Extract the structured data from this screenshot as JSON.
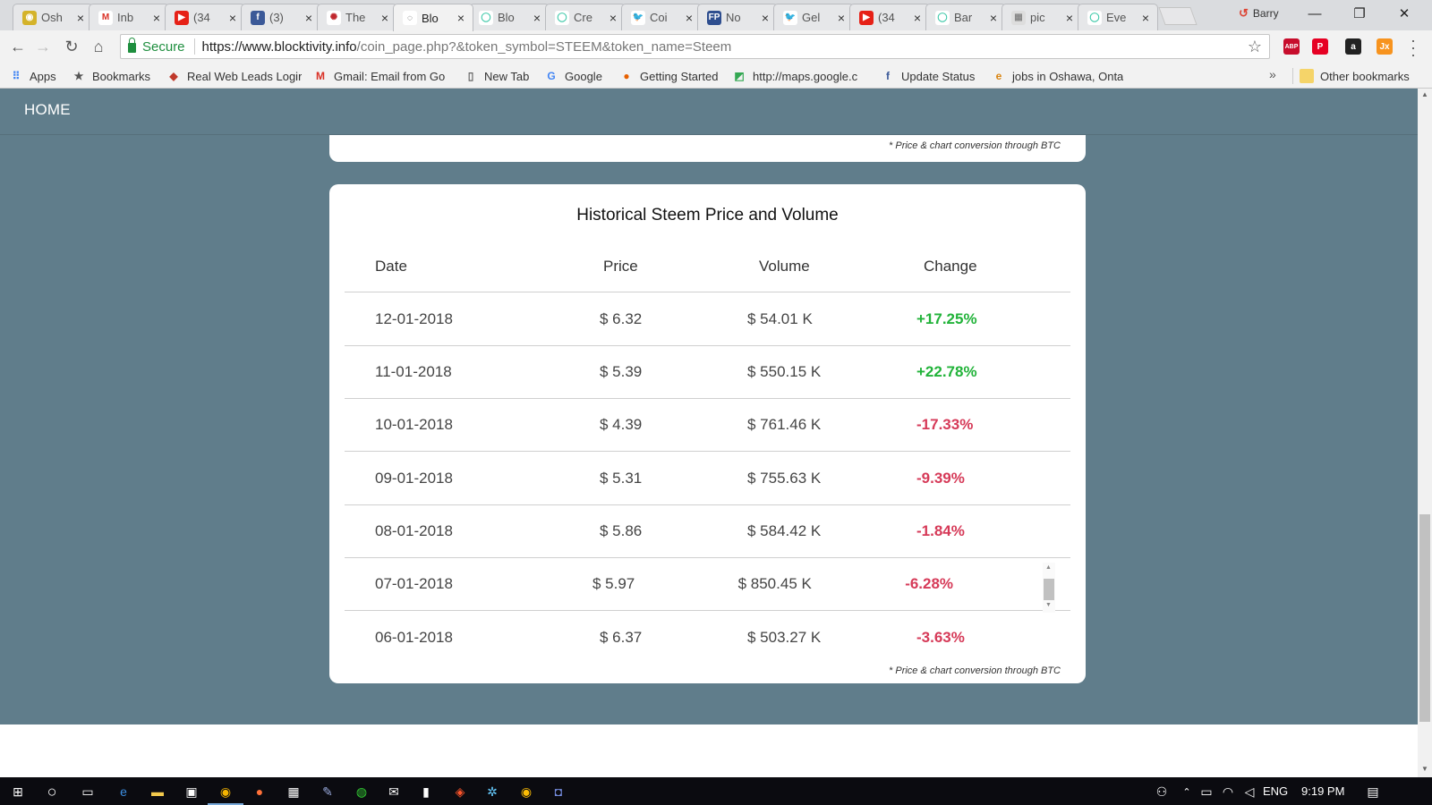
{
  "browser": {
    "tabs": [
      {
        "title": "Osh",
        "color": "#d4b32a",
        "glyph": "◉"
      },
      {
        "title": "Inb",
        "color": "#ffffff",
        "glyph": "M",
        "glyph_color": "#d93025"
      },
      {
        "title": "(34",
        "color": "#e62117",
        "glyph": "▶"
      },
      {
        "title": "(3)",
        "color": "#3b5998",
        "glyph": "f"
      },
      {
        "title": "The",
        "color": "#ffffff",
        "glyph": "✺",
        "glyph_color": "#c0272d"
      },
      {
        "title": "Blo",
        "color": "#ffffff",
        "glyph": "◌",
        "glyph_color": "#444"
      },
      {
        "title": "Blo",
        "color": "#ffffff",
        "glyph": "◯",
        "glyph_color": "#3cc8a8"
      },
      {
        "title": "Cre",
        "color": "#ffffff",
        "glyph": "◯",
        "glyph_color": "#3cc8a8"
      },
      {
        "title": "Coi",
        "color": "#ffffff",
        "glyph": "🐦",
        "glyph_color": "#1da1f2"
      },
      {
        "title": "No",
        "color": "#2e4e8f",
        "glyph": "FP"
      },
      {
        "title": "Gel",
        "color": "#ffffff",
        "glyph": "🐦",
        "glyph_color": "#1da1f2"
      },
      {
        "title": "(34",
        "color": "#e62117",
        "glyph": "▶"
      },
      {
        "title": "Bar",
        "color": "#ffffff",
        "glyph": "◯",
        "glyph_color": "#3cc8a8"
      },
      {
        "title": "pic",
        "color": "#dddddd",
        "glyph": "▦",
        "glyph_color": "#888"
      },
      {
        "title": "Eve",
        "color": "#ffffff",
        "glyph": "◯",
        "glyph_color": "#3cc8a8"
      }
    ],
    "active_tab_index": 5,
    "profile_name": "Barry",
    "window_controls": {
      "minimize": "—",
      "restore": "❐",
      "close": "✕"
    },
    "address": {
      "secure_label": "Secure",
      "url_host": "https://www.blocktivity.info",
      "url_rest": "/coin_page.php?&token_symbol=STEEM&token_name=Steem"
    },
    "extensions": [
      {
        "name": "adblock-icon",
        "label": "ABP",
        "color": "#c70d2c"
      },
      {
        "name": "pinterest-icon",
        "label": "P",
        "color": "#e60023"
      },
      {
        "name": "amazon-icon",
        "label": "a",
        "color": "#222222"
      },
      {
        "name": "jx-icon",
        "label": "Jx",
        "color": "#f7931e"
      }
    ],
    "bookmarks": [
      {
        "label": "Apps",
        "icon": "apps-grid-icon",
        "glyph": "⠿",
        "color": "#4285f4"
      },
      {
        "label": "Bookmarks",
        "icon": "star-icon",
        "glyph": "★",
        "color": "#555"
      },
      {
        "label": "Real Web Leads Logir",
        "icon": "leads-icon",
        "glyph": "◆",
        "color": "#c0392b"
      },
      {
        "label": "Gmail: Email from Go",
        "icon": "gmail-icon",
        "glyph": "M",
        "color": "#d93025"
      },
      {
        "label": "New Tab",
        "icon": "page-icon",
        "glyph": "▯",
        "color": "#666"
      },
      {
        "label": "Google",
        "icon": "google-icon",
        "glyph": "G",
        "color": "#4285f4"
      },
      {
        "label": "Getting Started",
        "icon": "firefox-icon",
        "glyph": "●",
        "color": "#e66000"
      },
      {
        "label": "http://maps.google.c",
        "icon": "maps-icon",
        "glyph": "◩",
        "color": "#34a853"
      },
      {
        "label": "Update Status",
        "icon": "facebook-icon",
        "glyph": "f",
        "color": "#3b5998"
      },
      {
        "label": "jobs in Oshawa, Onta",
        "icon": "ie-icon",
        "glyph": "e",
        "color": "#d9830f"
      }
    ],
    "bookmarks_more": "»",
    "other_bookmarks": "Other bookmarks"
  },
  "site": {
    "nav_home": "HOME",
    "top_card_footnote": "* Price & chart conversion through BTC",
    "table_title": "Historical Steem Price and Volume",
    "columns": [
      "Date",
      "Price",
      "Volume",
      "Change"
    ],
    "rows": [
      {
        "date": "12-01-2018",
        "price": "$ 6.32",
        "volume": "$ 54.01 K",
        "change": "+17.25%"
      },
      {
        "date": "11-01-2018",
        "price": "$ 5.39",
        "volume": "$ 550.15 K",
        "change": "+22.78%"
      },
      {
        "date": "10-01-2018",
        "price": "$ 4.39",
        "volume": "$ 761.46 K",
        "change": "-17.33%"
      },
      {
        "date": "09-01-2018",
        "price": "$ 5.31",
        "volume": "$ 755.63 K",
        "change": "-9.39%"
      },
      {
        "date": "08-01-2018",
        "price": "$ 5.86",
        "volume": "$ 584.42 K",
        "change": "-1.84%"
      },
      {
        "date": "07-01-2018",
        "price": "$ 5.97",
        "volume": "$ 850.45 K",
        "change": "-6.28%"
      },
      {
        "date": "06-01-2018",
        "price": "$ 6.37",
        "volume": "$ 503.27 K",
        "change": "-3.63%"
      }
    ],
    "bottom_footnote": "* Price & chart conversion through BTC",
    "colors": {
      "page_bg": "#607d8b",
      "positive": "#22b33a",
      "negative": "#d63a58"
    }
  },
  "taskbar": {
    "language": "ENG",
    "time": "9:19 PM"
  }
}
